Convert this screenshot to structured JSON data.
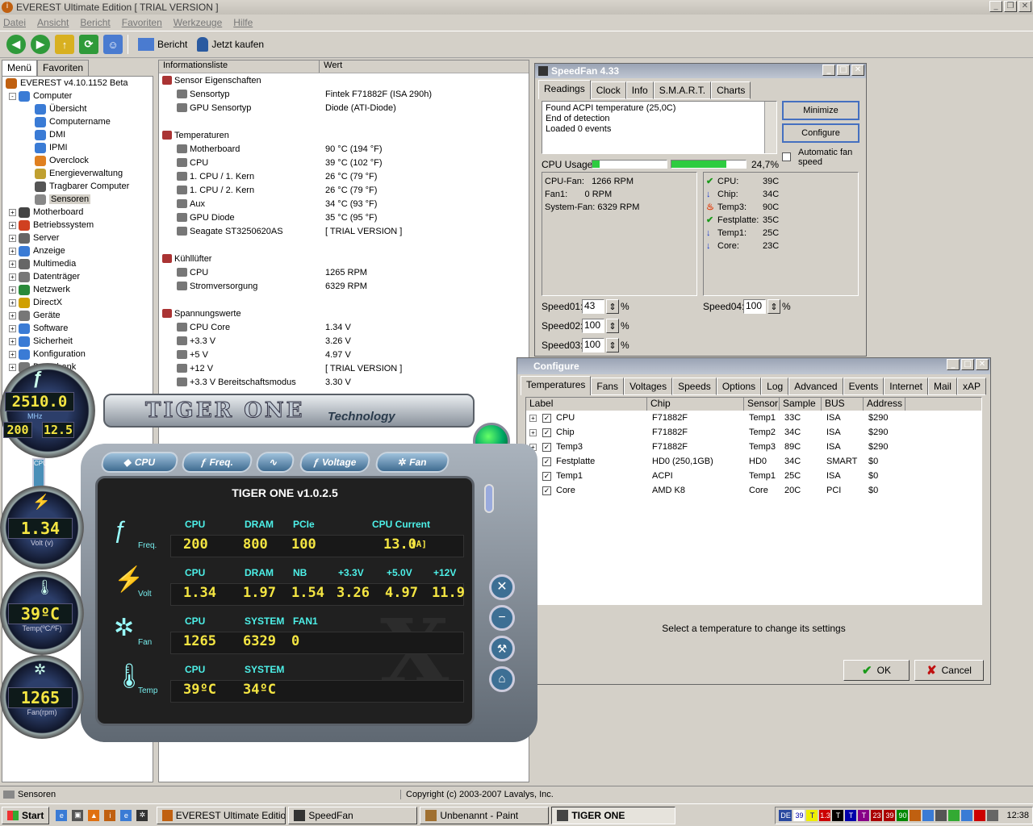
{
  "everest": {
    "title": "EVEREST Ultimate Edition  [ TRIAL VERSION ]",
    "menu": [
      "Datei",
      "Ansicht",
      "Bericht",
      "Favoriten",
      "Werkzeuge",
      "Hilfe"
    ],
    "toolbar": {
      "report": "Bericht",
      "buy": "Jetzt kaufen"
    },
    "tabs": [
      "Menü",
      "Favoriten"
    ],
    "tree": [
      {
        "label": "EVEREST v4.10.1152 Beta",
        "lvl": 0,
        "exp": "",
        "c": "#c06010"
      },
      {
        "label": "Computer",
        "lvl": 1,
        "exp": "-",
        "c": "#3a7bd5"
      },
      {
        "label": "Übersicht",
        "lvl": 2,
        "exp": "",
        "c": "#3a7bd5"
      },
      {
        "label": "Computername",
        "lvl": 2,
        "exp": "",
        "c": "#3a7bd5"
      },
      {
        "label": "DMI",
        "lvl": 2,
        "exp": "",
        "c": "#3a7bd5"
      },
      {
        "label": "IPMI",
        "lvl": 2,
        "exp": "",
        "c": "#3a7bd5"
      },
      {
        "label": "Overclock",
        "lvl": 2,
        "exp": "",
        "c": "#e08020"
      },
      {
        "label": "Energieverwaltung",
        "lvl": 2,
        "exp": "",
        "c": "#c0a030"
      },
      {
        "label": "Tragbarer Computer",
        "lvl": 2,
        "exp": "",
        "c": "#555"
      },
      {
        "label": "Sensoren",
        "lvl": 2,
        "exp": "",
        "c": "#888",
        "sel": true
      },
      {
        "label": "Motherboard",
        "lvl": 0,
        "exp": "+",
        "c": "#444"
      },
      {
        "label": "Betriebssystem",
        "lvl": 0,
        "exp": "+",
        "c": "#d04020"
      },
      {
        "label": "Server",
        "lvl": 0,
        "exp": "+",
        "c": "#666"
      },
      {
        "label": "Anzeige",
        "lvl": 0,
        "exp": "+",
        "c": "#3a7bd5"
      },
      {
        "label": "Multimedia",
        "lvl": 0,
        "exp": "+",
        "c": "#666"
      },
      {
        "label": "Datenträger",
        "lvl": 0,
        "exp": "+",
        "c": "#777"
      },
      {
        "label": "Netzwerk",
        "lvl": 0,
        "exp": "+",
        "c": "#2a8a3a"
      },
      {
        "label": "DirectX",
        "lvl": 0,
        "exp": "+",
        "c": "#d0a000"
      },
      {
        "label": "Geräte",
        "lvl": 0,
        "exp": "+",
        "c": "#777"
      },
      {
        "label": "Software",
        "lvl": 0,
        "exp": "+",
        "c": "#3a7bd5"
      },
      {
        "label": "Sicherheit",
        "lvl": 0,
        "exp": "+",
        "c": "#3a7bd5"
      },
      {
        "label": "Konfiguration",
        "lvl": 0,
        "exp": "+",
        "c": "#3a7bd5"
      },
      {
        "label": "Datenbank",
        "lvl": 0,
        "exp": "+",
        "c": "#777"
      }
    ],
    "list_header": {
      "col1": "Informationsliste",
      "col2": "Wert"
    },
    "list": [
      {
        "t": "g",
        "label": "Sensor Eigenschaften"
      },
      {
        "t": "i",
        "label": "Sensortyp",
        "value": "Fintek F71882F  (ISA 290h)"
      },
      {
        "t": "i",
        "label": "GPU Sensortyp",
        "value": "Diode  (ATI-Diode)"
      },
      {
        "t": "s"
      },
      {
        "t": "g",
        "label": "Temperaturen"
      },
      {
        "t": "i",
        "label": "Motherboard",
        "value": "90 °C  (194 °F)"
      },
      {
        "t": "i",
        "label": "CPU",
        "value": "39 °C  (102 °F)"
      },
      {
        "t": "i",
        "label": "1. CPU / 1. Kern",
        "value": "26 °C  (79 °F)"
      },
      {
        "t": "i",
        "label": "1. CPU / 2. Kern",
        "value": "26 °C  (79 °F)"
      },
      {
        "t": "i",
        "label": "Aux",
        "value": "34 °C  (93 °F)"
      },
      {
        "t": "i",
        "label": "GPU Diode",
        "value": "35 °C  (95 °F)"
      },
      {
        "t": "i",
        "label": "Seagate ST3250620AS",
        "value": "[ TRIAL VERSION ]"
      },
      {
        "t": "s"
      },
      {
        "t": "g",
        "label": "Kühllüfter"
      },
      {
        "t": "i",
        "label": "CPU",
        "value": "1265 RPM"
      },
      {
        "t": "i",
        "label": "Stromversorgung",
        "value": "6329 RPM"
      },
      {
        "t": "s"
      },
      {
        "t": "g",
        "label": "Spannungswerte"
      },
      {
        "t": "i",
        "label": "CPU Core",
        "value": "1.34 V"
      },
      {
        "t": "i",
        "label": "+3.3 V",
        "value": "3.26 V"
      },
      {
        "t": "i",
        "label": "+5 V",
        "value": "4.97 V"
      },
      {
        "t": "i",
        "label": "+12 V",
        "value": "[ TRIAL VERSION ]"
      },
      {
        "t": "i",
        "label": "+3.3 V Bereitschaftsmodus",
        "value": "3.30 V"
      }
    ],
    "status_left": "Sensoren",
    "status_right": "Copyright (c) 2003-2007 Lavalys, Inc."
  },
  "speedfan": {
    "title": "SpeedFan 4.33",
    "tabs": [
      "Readings",
      "Clock",
      "Info",
      "S.M.A.R.T.",
      "Charts"
    ],
    "log": [
      "Found ACPI temperature (25,0C)",
      "End of detection",
      "Loaded 0 events"
    ],
    "minimize": "Minimize",
    "configure": "Configure",
    "auto_fan": "Automatic fan speed",
    "cpu_usage_label": "CPU Usage",
    "cpu_usage_value": "24,7%",
    "cpu_usage_frac": 0.247,
    "fans": [
      "CPU-Fan:   1266 RPM",
      "Fan1:       0 RPM",
      "System-Fan: 6329 RPM"
    ],
    "temps": [
      {
        "name": "CPU:",
        "val": "39C",
        "icon": "check"
      },
      {
        "name": "Chip:",
        "val": "34C",
        "icon": "down"
      },
      {
        "name": "Temp3:",
        "val": "90C",
        "icon": "fire"
      },
      {
        "name": "Festplatte:",
        "val": "35C",
        "icon": "check"
      },
      {
        "name": "Temp1:",
        "val": "25C",
        "icon": "down"
      },
      {
        "name": "Core:",
        "val": "23C",
        "icon": "down"
      }
    ],
    "speeds": [
      {
        "label": "Speed01:",
        "val": "43"
      },
      {
        "label": "Speed02:",
        "val": "100"
      },
      {
        "label": "Speed03:",
        "val": "100"
      },
      {
        "label": "Speed04:",
        "val": "100"
      }
    ],
    "pct": "%"
  },
  "configure": {
    "title": "Configure",
    "tabs": [
      "Temperatures",
      "Fans",
      "Voltages",
      "Speeds",
      "Options",
      "Log",
      "Advanced",
      "Events",
      "Internet",
      "Mail",
      "xAP"
    ],
    "headers": [
      "Label",
      "Chip",
      "Sensor",
      "Sample",
      "BUS",
      "Address"
    ],
    "rows": [
      [
        "CPU",
        "F71882F",
        "Temp1",
        "33C",
        "ISA",
        "$290"
      ],
      [
        "Chip",
        "F71882F",
        "Temp2",
        "34C",
        "ISA",
        "$290"
      ],
      [
        "Temp3",
        "F71882F",
        "Temp3",
        "89C",
        "ISA",
        "$290"
      ],
      [
        "Festplatte",
        "HD0 (250,1GB)",
        "HD0",
        "34C",
        "SMART",
        "$0"
      ],
      [
        "Temp1",
        "ACPI",
        "Temp1",
        "25C",
        "ISA",
        "$0"
      ],
      [
        "Core",
        "AMD K8",
        "Core",
        "20C",
        "PCI",
        "$0"
      ]
    ],
    "hint": "Select a temperature to change its settings",
    "ok": "OK",
    "cancel": "Cancel"
  },
  "tiger": {
    "logo": "TIGER ONE",
    "tech": "Technology",
    "version": "TIGER ONE   v1.0.2.5",
    "buttons": [
      "CPU",
      "Freq.",
      "",
      "Voltage",
      "Fan"
    ],
    "gauge_freq": "2510.0",
    "mhz": "MHz",
    "fsb": "200",
    "mult": "12.5",
    "gauge_volt": "1.34",
    "volt_label": "Volt (v)",
    "gauge_temp": "39ºC",
    "temp_label": "Temp(ºC/ºF)",
    "gauge_fan": "1265",
    "fan_label": "Fan(rpm)",
    "freq": {
      "lab": "Freq.",
      "heads": [
        "CPU",
        "DRAM",
        "PCIe",
        "CPU Current"
      ],
      "vals": [
        "200",
        "800",
        "100",
        "13.0"
      ],
      "unit": "[A]"
    },
    "volt": {
      "lab": "Volt",
      "heads": [
        "CPU",
        "DRAM",
        "NB",
        "+3.3V",
        "+5.0V",
        "+12V"
      ],
      "vals": [
        "1.34",
        "1.97",
        "1.54",
        "3.26",
        "4.97",
        "11.9"
      ]
    },
    "fan": {
      "lab": "Fan",
      "heads": [
        "CPU",
        "SYSTEM",
        "FAN1"
      ],
      "vals": [
        "1265",
        "6329",
        "0"
      ]
    },
    "temp": {
      "lab": "Temp",
      "heads": [
        "CPU",
        "SYSTEM"
      ],
      "vals": [
        "39ºC",
        "34ºC"
      ]
    }
  },
  "taskbar": {
    "start": "Start",
    "tasks": [
      "EVEREST Ultimate Edition...",
      "SpeedFan",
      "Unbenannt - Paint",
      "TIGER ONE"
    ],
    "tray": [
      "DE",
      "39",
      "T",
      "1.3",
      "T",
      "T",
      "T",
      "23",
      "39",
      "90"
    ],
    "clock": "12:38"
  }
}
